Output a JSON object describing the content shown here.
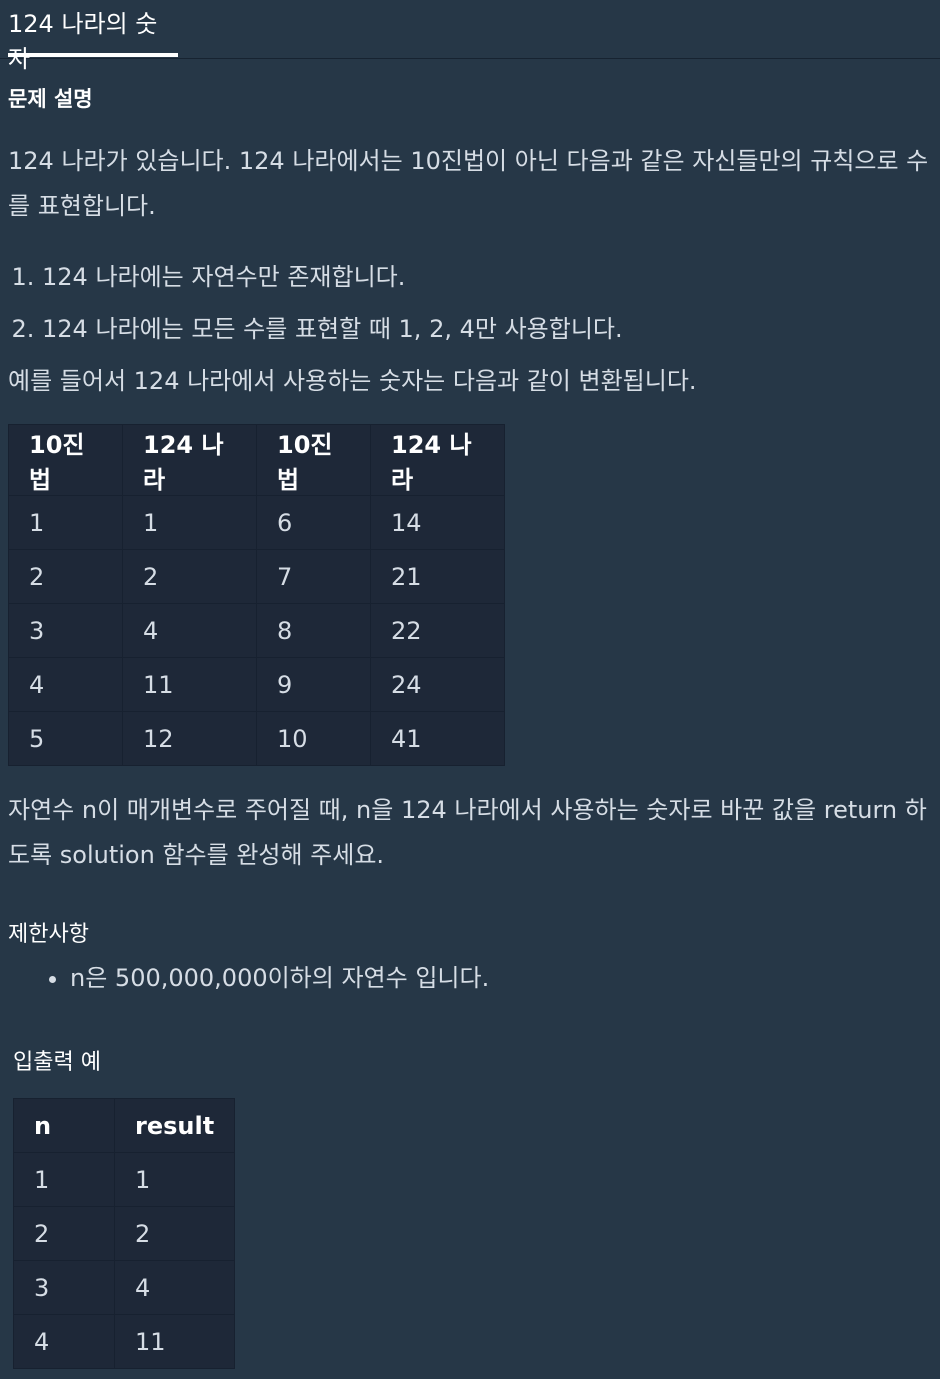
{
  "tab": {
    "title": "124 나라의 숫자"
  },
  "description": {
    "heading": "문제 설명",
    "intro": "124 나라가 있습니다. 124 나라에서는 10진법이 아닌 다음과 같은 자신들만의 규칙으로 수를 표현합니다.",
    "rules": [
      "124 나라에는 자연수만 존재합니다.",
      "124 나라에는 모든 수를 표현할 때 1, 2, 4만 사용합니다."
    ],
    "example_sentence": "예를 들어서 124 나라에서 사용하는 숫자는 다음과 같이 변환됩니다.",
    "conversion_table": {
      "headers": [
        "10진법",
        "124 나라",
        "10진법",
        "124 나라"
      ],
      "rows": [
        [
          "1",
          "1",
          "6",
          "14"
        ],
        [
          "2",
          "2",
          "7",
          "21"
        ],
        [
          "3",
          "4",
          "8",
          "22"
        ],
        [
          "4",
          "11",
          "9",
          "24"
        ],
        [
          "5",
          "12",
          "10",
          "41"
        ]
      ]
    },
    "task": "자연수 n이 매개변수로 주어질 때, n을 124 나라에서 사용하는 숫자로 바꾼 값을 return 하도록 solution 함수를 완성해 주세요."
  },
  "constraints": {
    "heading": "제한사항",
    "items": [
      "n은 500,000,000이하의 자연수 입니다."
    ]
  },
  "io_example": {
    "heading": "입출력 예",
    "headers": [
      "n",
      "result"
    ],
    "rows": [
      [
        "1",
        "1"
      ],
      [
        "2",
        "2"
      ],
      [
        "3",
        "4"
      ],
      [
        "4",
        "11"
      ]
    ]
  }
}
